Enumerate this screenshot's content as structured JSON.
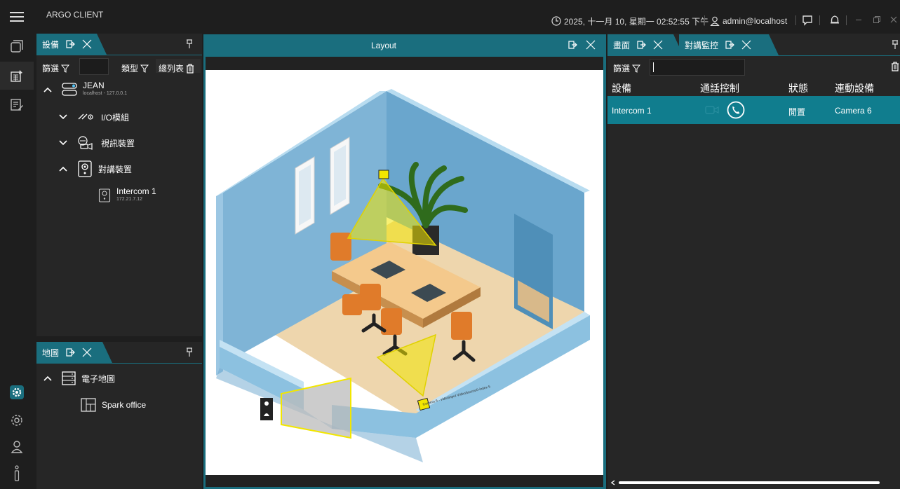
{
  "app": {
    "title": "ARGO CLIENT"
  },
  "titlebar": {
    "datetime": "2025, 十一月 10, 星期一 02:52:55 下午",
    "user": "admin@localhost"
  },
  "devices_panel": {
    "tab_label": "設備",
    "filter_label": "篩選",
    "type_label": "類型",
    "overview_label": "總列表",
    "tree": {
      "server": {
        "name": "JEAN",
        "address": "localhost - 127.0.0.1"
      },
      "io_module": "I/O模組",
      "video_device": "視訊裝置",
      "intercom_device": "對講裝置",
      "intercom": {
        "name": "Intercom 1",
        "address": "172.21.7.12"
      }
    }
  },
  "map_panel": {
    "tab_label": "地圖",
    "emap_label": "電子地圖",
    "office_label": "Spark office"
  },
  "layout_panel": {
    "title": "Layout",
    "camera_label": "Camera 6 - videoinput VideoSource0-index 5"
  },
  "right_panel": {
    "tab1_label": "畫面",
    "tab2_label": "對講監控",
    "filter_label": "篩選",
    "columns": [
      "設備",
      "通話控制",
      "狀態",
      "連動設備"
    ],
    "row": {
      "device": "Intercom 1",
      "status": "閒置",
      "linked": "Camera 6"
    }
  },
  "colors": {
    "accent": "#1a6e7e",
    "selected_row": "#107d8e",
    "camera_yellow": "#f2e600"
  }
}
